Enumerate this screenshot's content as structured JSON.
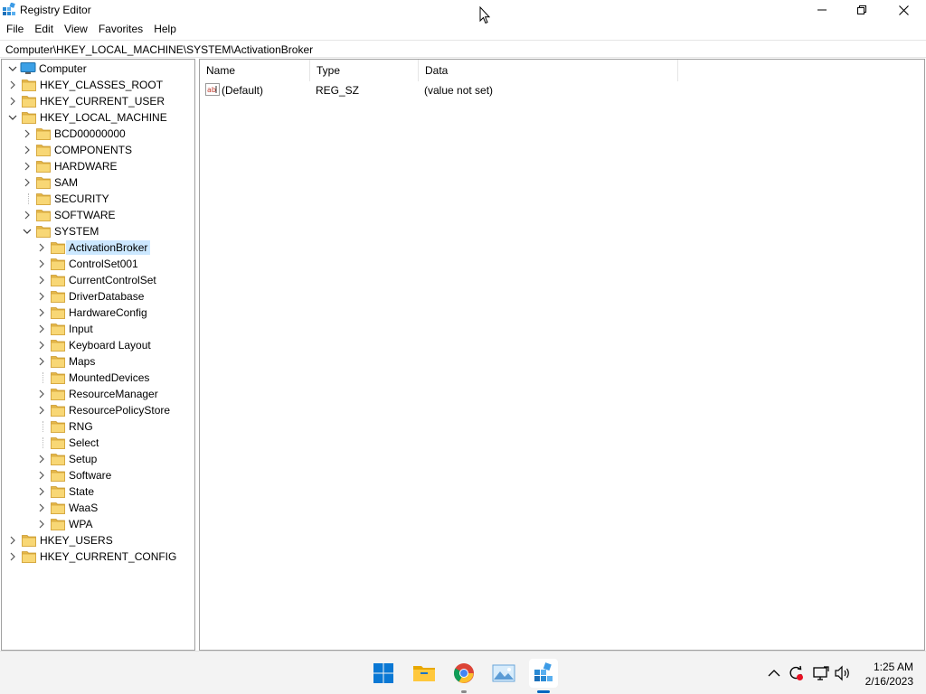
{
  "window": {
    "title": "Registry Editor"
  },
  "menu": [
    "File",
    "Edit",
    "View",
    "Favorites",
    "Help"
  ],
  "address": "Computer\\HKEY_LOCAL_MACHINE\\SYSTEM\\ActivationBroker",
  "tree": {
    "root": "Computer",
    "items": [
      {
        "label": "HKEY_CLASSES_ROOT",
        "level": 1,
        "state": "collapsed"
      },
      {
        "label": "HKEY_CURRENT_USER",
        "level": 1,
        "state": "collapsed"
      },
      {
        "label": "HKEY_LOCAL_MACHINE",
        "level": 1,
        "state": "expanded"
      },
      {
        "label": "BCD00000000",
        "level": 2,
        "state": "collapsed"
      },
      {
        "label": "COMPONENTS",
        "level": 2,
        "state": "collapsed"
      },
      {
        "label": "HARDWARE",
        "level": 2,
        "state": "collapsed"
      },
      {
        "label": "SAM",
        "level": 2,
        "state": "collapsed"
      },
      {
        "label": "SECURITY",
        "level": 2,
        "state": "leaf"
      },
      {
        "label": "SOFTWARE",
        "level": 2,
        "state": "collapsed"
      },
      {
        "label": "SYSTEM",
        "level": 2,
        "state": "expanded"
      },
      {
        "label": "ActivationBroker",
        "level": 3,
        "state": "collapsed",
        "selected": true
      },
      {
        "label": "ControlSet001",
        "level": 3,
        "state": "collapsed"
      },
      {
        "label": "CurrentControlSet",
        "level": 3,
        "state": "collapsed"
      },
      {
        "label": "DriverDatabase",
        "level": 3,
        "state": "collapsed"
      },
      {
        "label": "HardwareConfig",
        "level": 3,
        "state": "collapsed"
      },
      {
        "label": "Input",
        "level": 3,
        "state": "collapsed"
      },
      {
        "label": "Keyboard Layout",
        "level": 3,
        "state": "collapsed"
      },
      {
        "label": "Maps",
        "level": 3,
        "state": "collapsed"
      },
      {
        "label": "MountedDevices",
        "level": 3,
        "state": "leaf"
      },
      {
        "label": "ResourceManager",
        "level": 3,
        "state": "collapsed"
      },
      {
        "label": "ResourcePolicyStore",
        "level": 3,
        "state": "collapsed"
      },
      {
        "label": "RNG",
        "level": 3,
        "state": "leaf"
      },
      {
        "label": "Select",
        "level": 3,
        "state": "leaf"
      },
      {
        "label": "Setup",
        "level": 3,
        "state": "collapsed"
      },
      {
        "label": "Software",
        "level": 3,
        "state": "collapsed"
      },
      {
        "label": "State",
        "level": 3,
        "state": "collapsed"
      },
      {
        "label": "WaaS",
        "level": 3,
        "state": "collapsed"
      },
      {
        "label": "WPA",
        "level": 3,
        "state": "collapsed"
      },
      {
        "label": "HKEY_USERS",
        "level": 1,
        "state": "collapsed"
      },
      {
        "label": "HKEY_CURRENT_CONFIG",
        "level": 1,
        "state": "collapsed"
      }
    ]
  },
  "list": {
    "columns": [
      "Name",
      "Type",
      "Data"
    ],
    "rows": [
      {
        "name": "(Default)",
        "type": "REG_SZ",
        "data": "(value not set)",
        "icon": "string-value-icon"
      }
    ]
  },
  "taskbar": {
    "apps": [
      "start-icon",
      "file-explorer-icon",
      "chrome-icon",
      "photos-icon",
      "registry-editor-icon"
    ],
    "tray": [
      "show-hidden-icons-chevron",
      "sync-icon",
      "network-icon",
      "volume-icon"
    ],
    "time": "1:25 AM",
    "date": "2/16/2023"
  },
  "colors": {
    "selection": "#cce8ff",
    "folder": "#f8d775",
    "accent": "#0067c0"
  }
}
